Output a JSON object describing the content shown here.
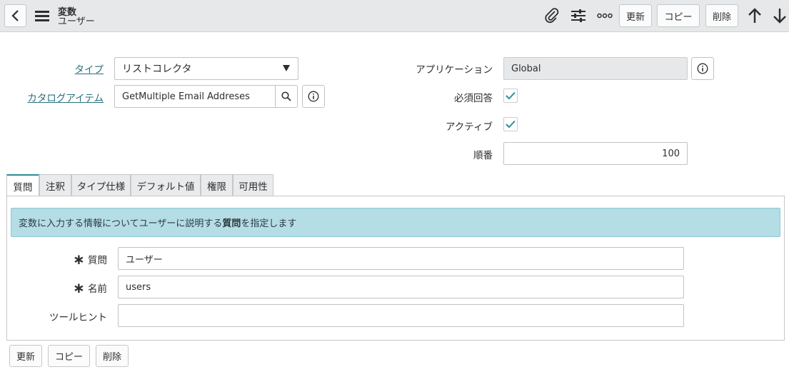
{
  "header": {
    "title": "変数",
    "subtitle": "ユーザー",
    "update_label": "更新",
    "copy_label": "コピー",
    "delete_label": "削除"
  },
  "form": {
    "type_label": "タイプ",
    "type_value": "リストコレクタ",
    "catalog_item_label": "カタログアイテム",
    "catalog_item_value": "GetMultiple Email Addreses",
    "application_label": "アプリケーション",
    "application_value": "Global",
    "mandatory_label": "必須回答",
    "mandatory_checked": true,
    "active_label": "アクティブ",
    "active_checked": true,
    "order_label": "順番",
    "order_value": "100"
  },
  "tabs": [
    {
      "label": "質問",
      "active": true
    },
    {
      "label": "注釈"
    },
    {
      "label": "タイプ仕様"
    },
    {
      "label": "デフォルト値"
    },
    {
      "label": "権限"
    },
    {
      "label": "可用性"
    }
  ],
  "question_tab": {
    "info_prefix": "変数に入力する情報についてユーザーに説明する",
    "info_bold": "質問",
    "info_suffix": "を指定します",
    "question_label": "質問",
    "question_value": "ユーザー",
    "name_label": "名前",
    "name_value": "users",
    "tooltip_label": "ツールヒント",
    "tooltip_value": ""
  },
  "footer": {
    "update_label": "更新",
    "copy_label": "コピー",
    "delete_label": "削除"
  },
  "colors": {
    "accent": "#2e8b98",
    "link": "#276f7a",
    "info_bg": "#b5dde6",
    "header_bg": "#e6e8ea"
  },
  "icons": [
    "back-arrow-icon",
    "hamburger-menu-icon",
    "paperclip-icon",
    "sliders-icon",
    "more-options-icon",
    "arrow-up-icon",
    "arrow-down-icon",
    "dropdown-caret-icon",
    "search-icon",
    "info-icon",
    "checkmark-icon",
    "required-asterisk-icon"
  ]
}
